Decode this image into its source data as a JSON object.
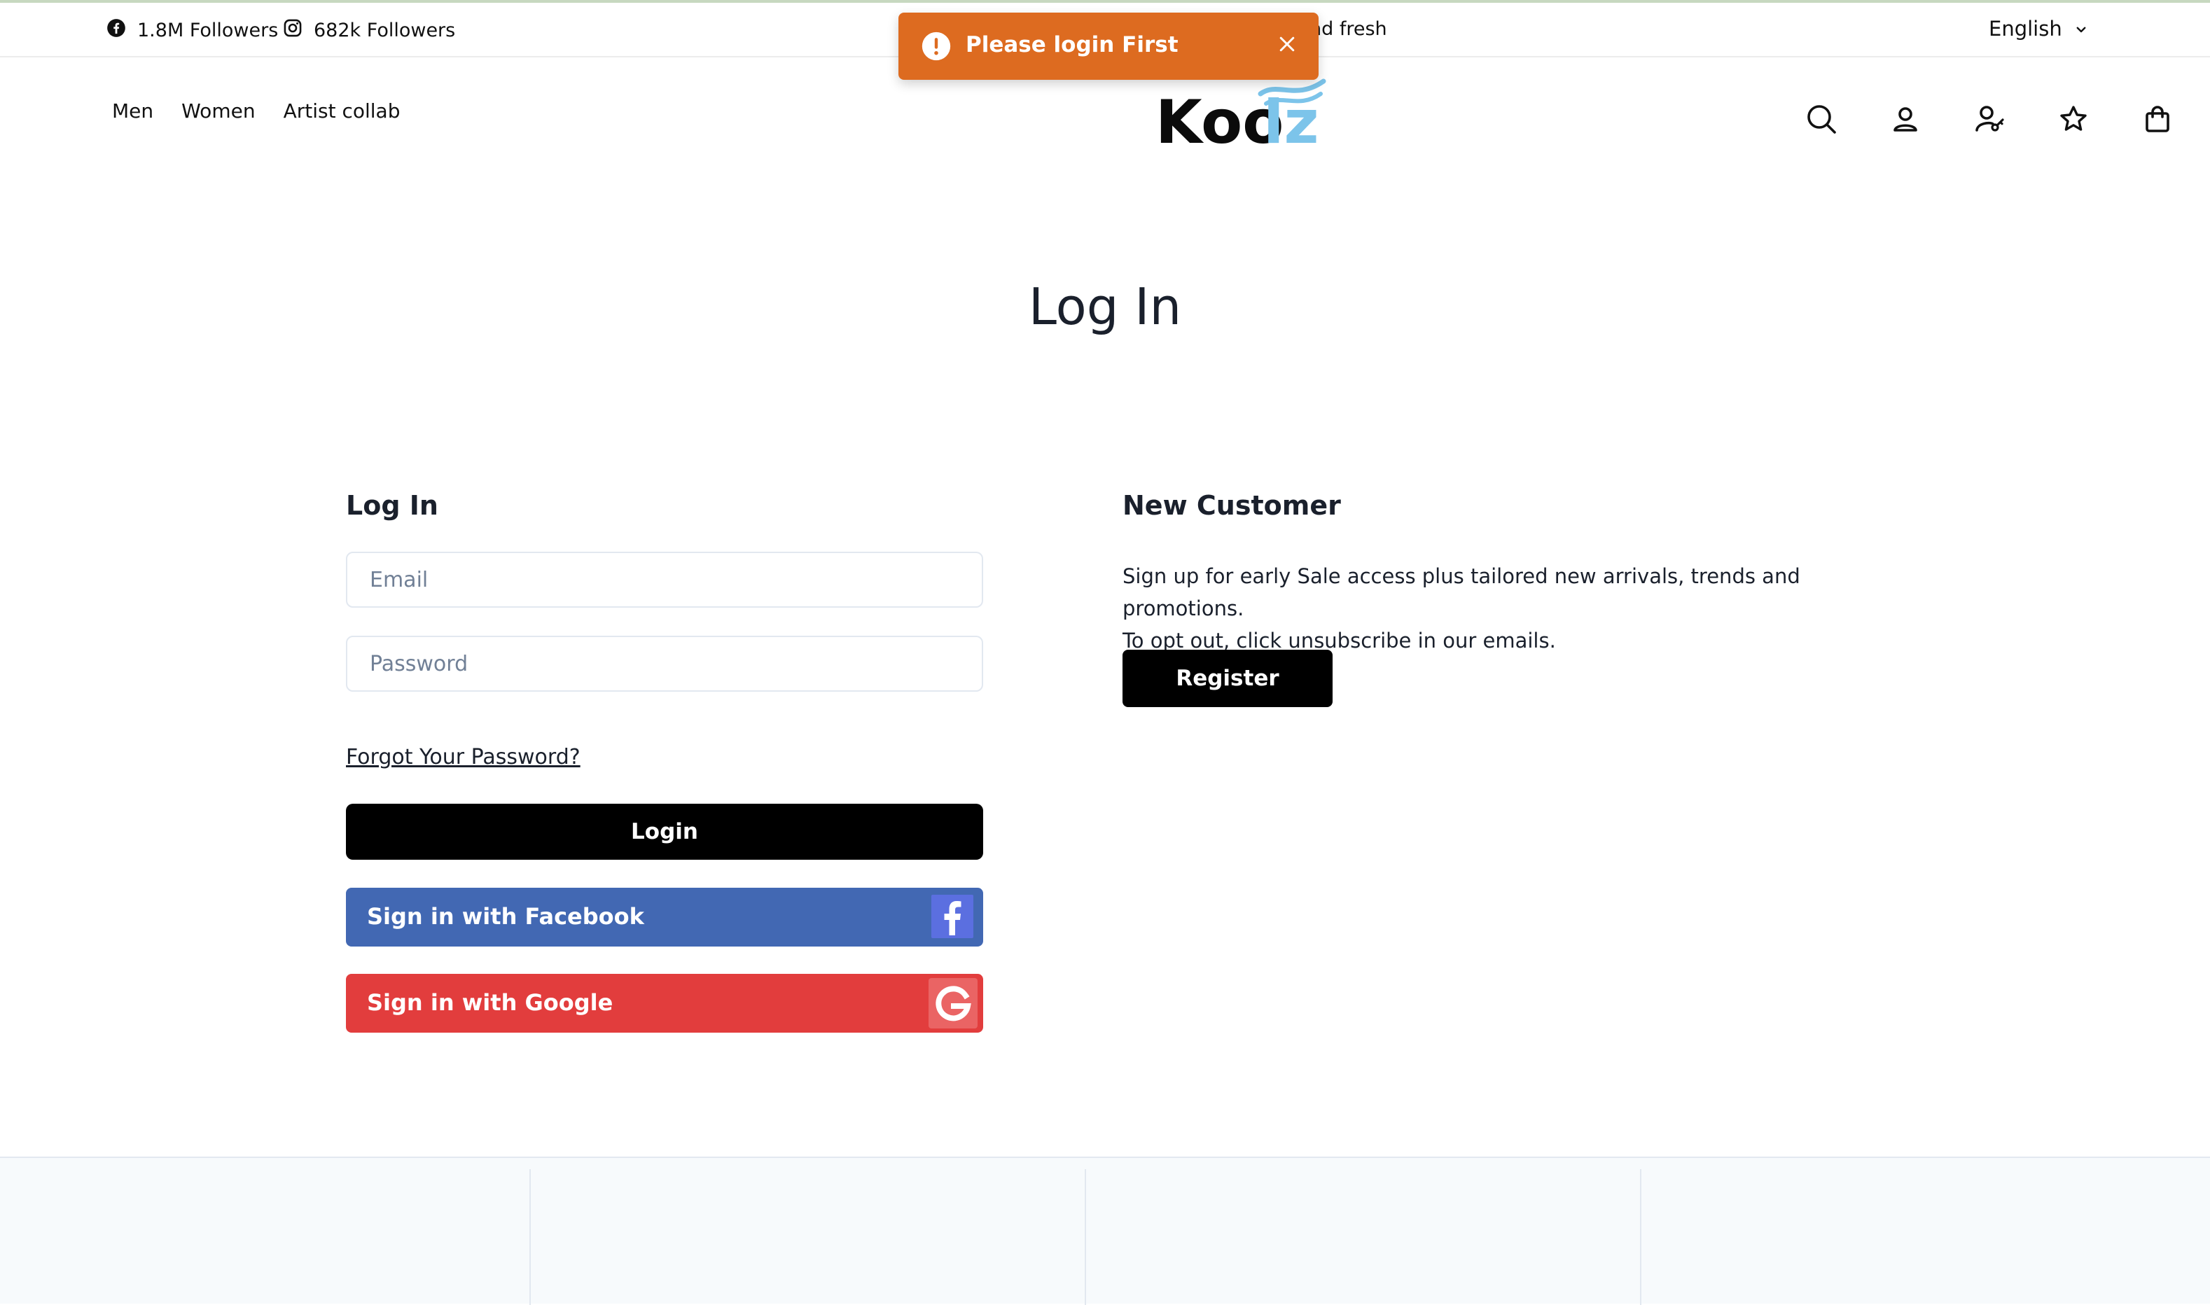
{
  "topbar": {
    "facebook_followers": "1.8M Followers",
    "instagram_followers": "682k Followers",
    "announcement": "nd fresh",
    "language": "English"
  },
  "nav": {
    "items": [
      {
        "label": "Men"
      },
      {
        "label": "Women"
      },
      {
        "label": "Artist collab"
      }
    ]
  },
  "brand": {
    "name": "Koolz",
    "logo_part1": "Koo",
    "logo_part2": "lz",
    "accent": "#7cc4ea"
  },
  "header_icons": [
    "search-icon",
    "account-icon",
    "user-key-icon",
    "wishlist-star-icon",
    "cart-bag-icon"
  ],
  "toast": {
    "message": "Please login First",
    "color": "#dd6b20"
  },
  "page": {
    "title": "Log In"
  },
  "login": {
    "heading": "Log In",
    "email_placeholder": "Email",
    "password_placeholder": "Password",
    "forgot_label": "Forgot Your Password?",
    "login_label": "Login",
    "facebook_label": "Sign in with Facebook",
    "google_label": "Sign in with Google",
    "facebook_color": "#4268b3",
    "google_color": "#e23d3d"
  },
  "new_customer": {
    "heading": "New Customer",
    "line1": "Sign up for early Sale access plus tailored new arrivals, trends and promotions.",
    "line2": "To opt out, click unsubscribe in our emails.",
    "register_label": "Register"
  }
}
